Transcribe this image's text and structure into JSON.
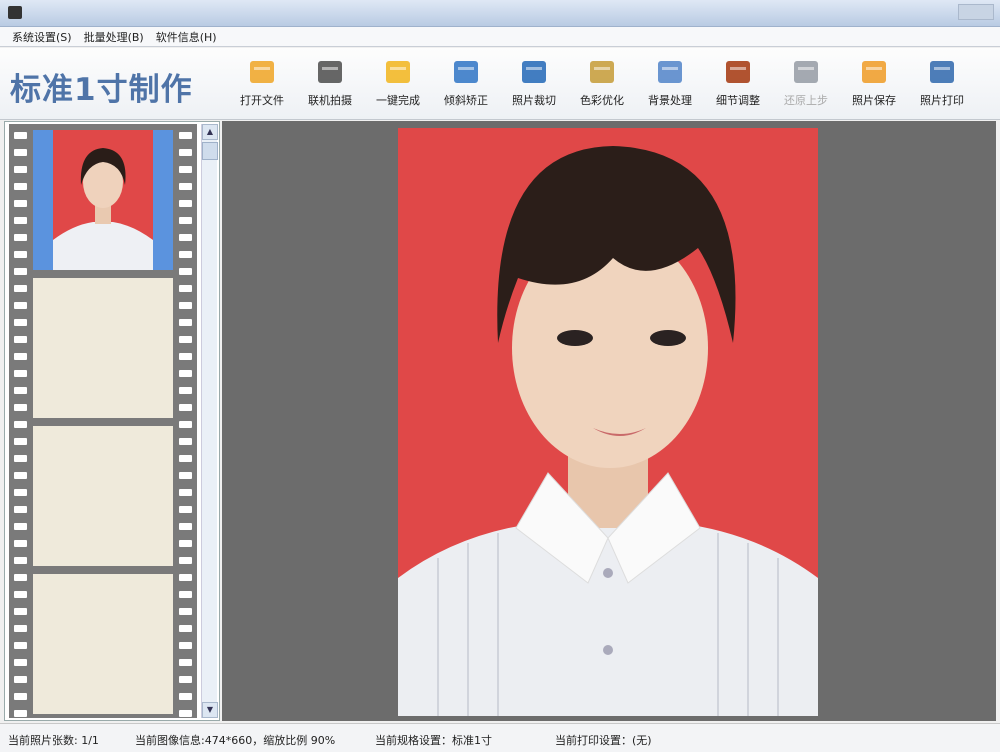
{
  "menu": [
    "系统设置(S)",
    "批量处理(B)",
    "软件信息(H)"
  ],
  "brand": "标准1寸制作",
  "tools": [
    {
      "label": "打开文件",
      "icon": "folder-icon",
      "color": "#f0a830"
    },
    {
      "label": "联机拍摄",
      "icon": "camera-icon",
      "color": "#555555"
    },
    {
      "label": "一键完成",
      "icon": "hand-icon",
      "color": "#f2b828"
    },
    {
      "label": "倾斜矫正",
      "icon": "rotate-icon",
      "color": "#3a7bc8"
    },
    {
      "label": "照片裁切",
      "icon": "crop-icon",
      "color": "#2e6fba"
    },
    {
      "label": "色彩优化",
      "icon": "color-bars-icon",
      "color": "#c8a040"
    },
    {
      "label": "背景处理",
      "icon": "brush-icon",
      "color": "#5a8acb"
    },
    {
      "label": "细节调整",
      "icon": "histogram-icon",
      "color": "#a8401a"
    },
    {
      "label": "还原上步",
      "icon": "undo-icon",
      "color": "#9aa0a8",
      "disabled": true
    },
    {
      "label": "照片保存",
      "icon": "save-icon",
      "color": "#f0a030"
    },
    {
      "label": "照片打印",
      "icon": "printer-icon",
      "color": "#3a6fb0"
    }
  ],
  "status": {
    "count": "当前照片张数: 1/1",
    "image_info": "当前图像信息:474*660，缩放比例 90%",
    "spec": "当前规格设置：标准1寸",
    "print": "当前打印设置：(无)"
  },
  "colors": {
    "photo_bg": "#e04848",
    "accent": "#4f74a8"
  }
}
